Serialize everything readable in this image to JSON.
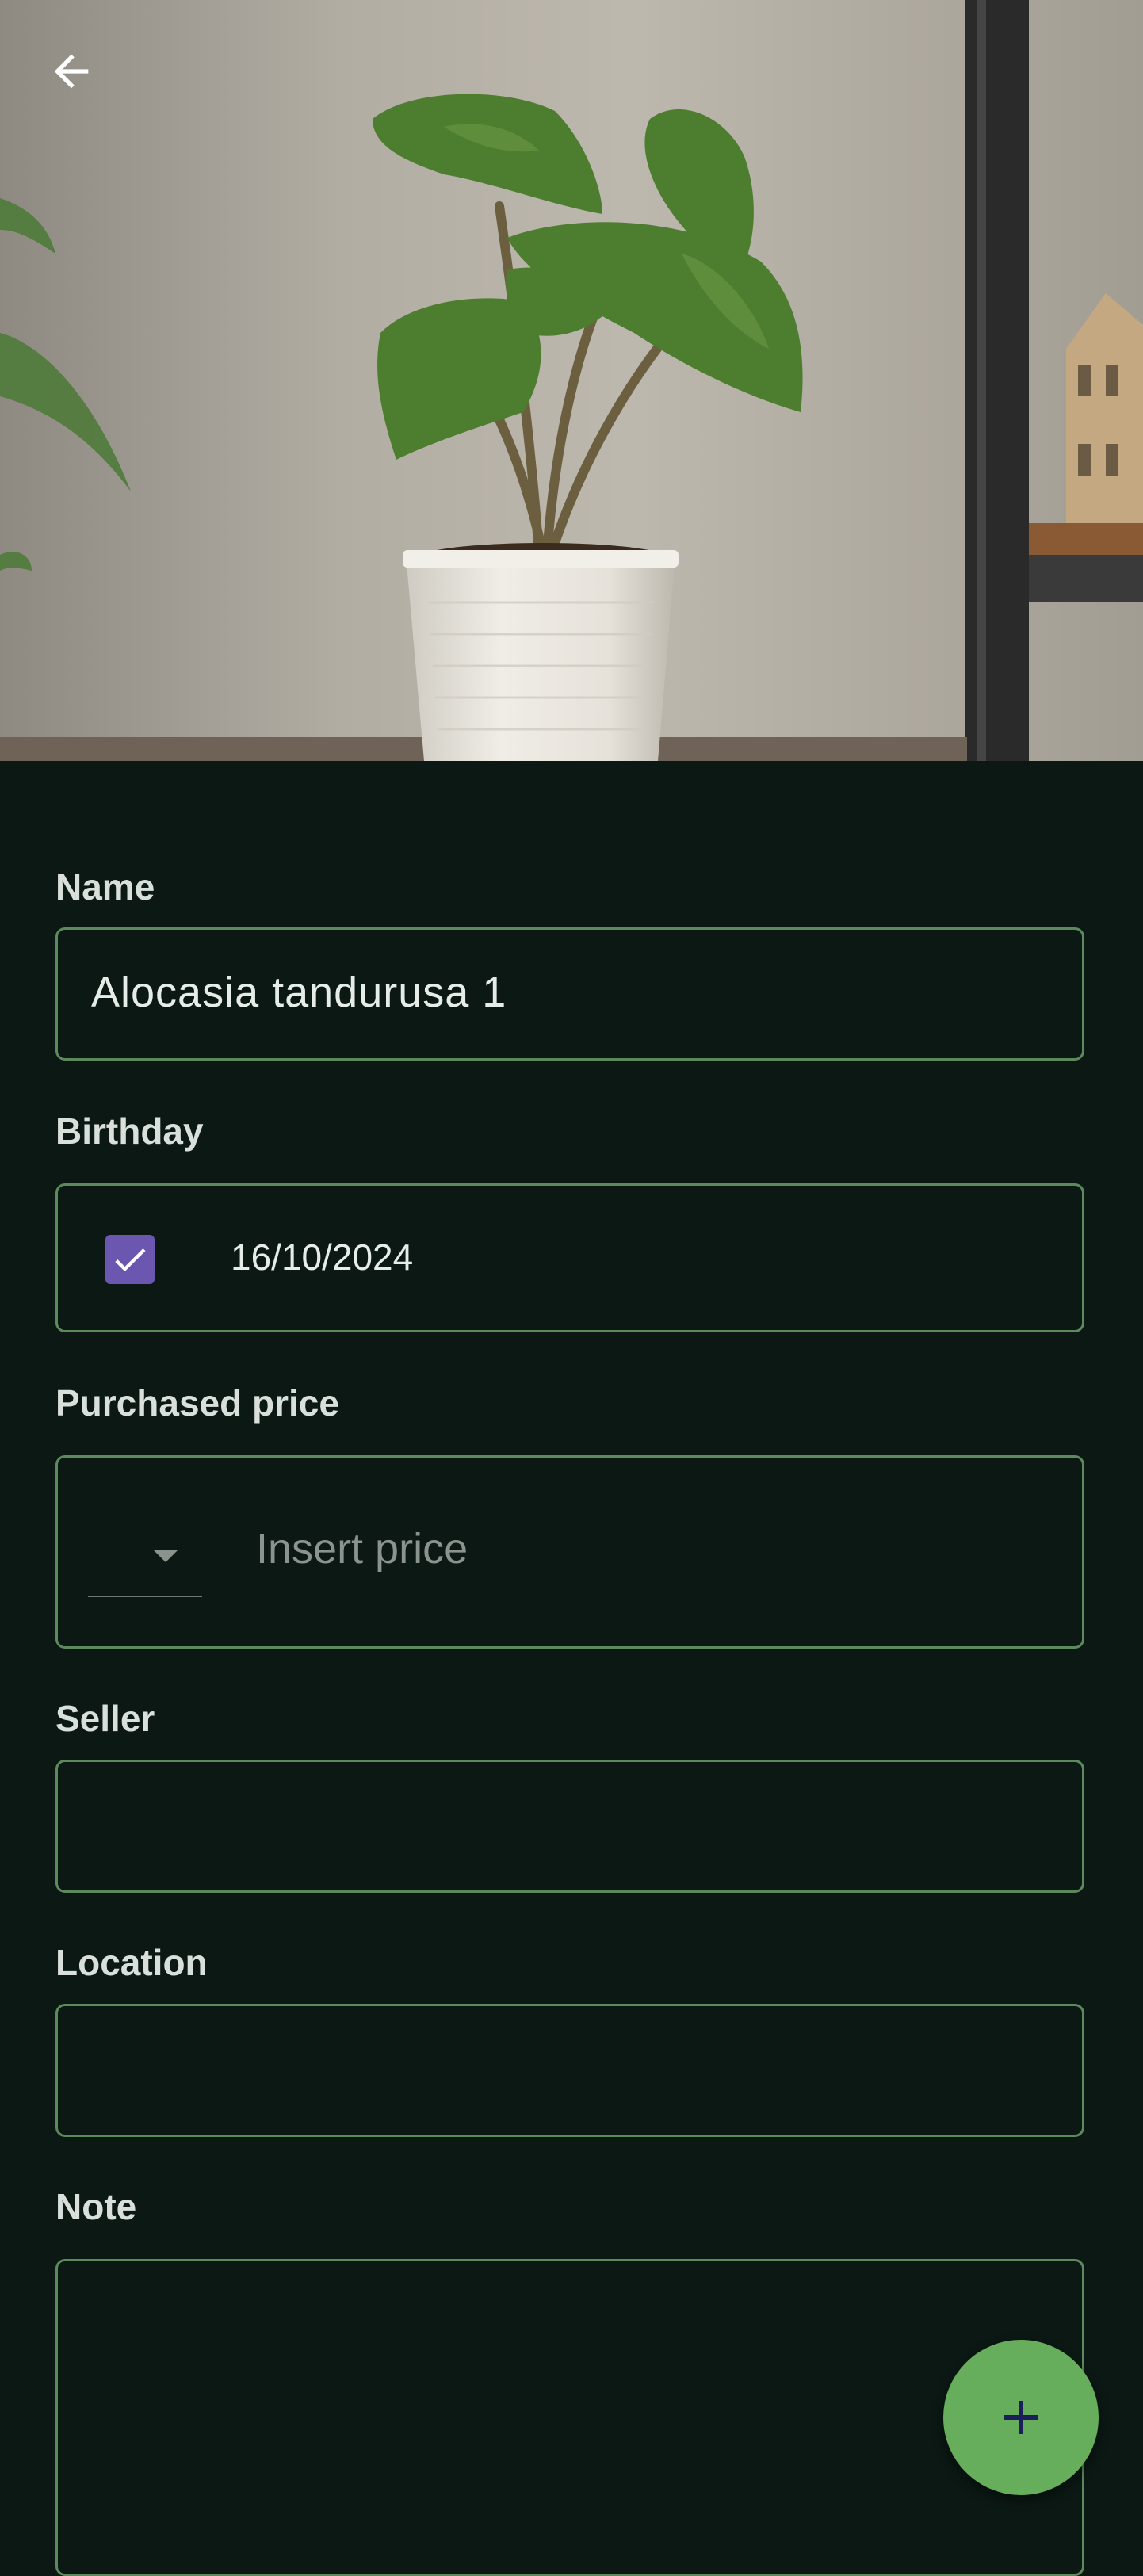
{
  "header": {
    "back_icon": "arrow-left-icon",
    "photo": "plant-photo"
  },
  "form": {
    "name": {
      "label": "Name",
      "value": "Alocasia tandurusa 1"
    },
    "birthday": {
      "label": "Birthday",
      "checked": true,
      "value": "16/10/2024"
    },
    "purchased_price": {
      "label": "Purchased price",
      "currency_value": "",
      "placeholder": "Insert price"
    },
    "seller": {
      "label": "Seller",
      "value": ""
    },
    "location": {
      "label": "Location",
      "value": ""
    },
    "note": {
      "label": "Note",
      "value": ""
    }
  },
  "fab": {
    "icon": "plus-icon"
  },
  "colors": {
    "background": "#0b1814",
    "field_border": "#5d8a5c",
    "checkbox": "#6c57b0",
    "fab": "#66ae5c",
    "fab_icon": "#1c1f5a"
  }
}
